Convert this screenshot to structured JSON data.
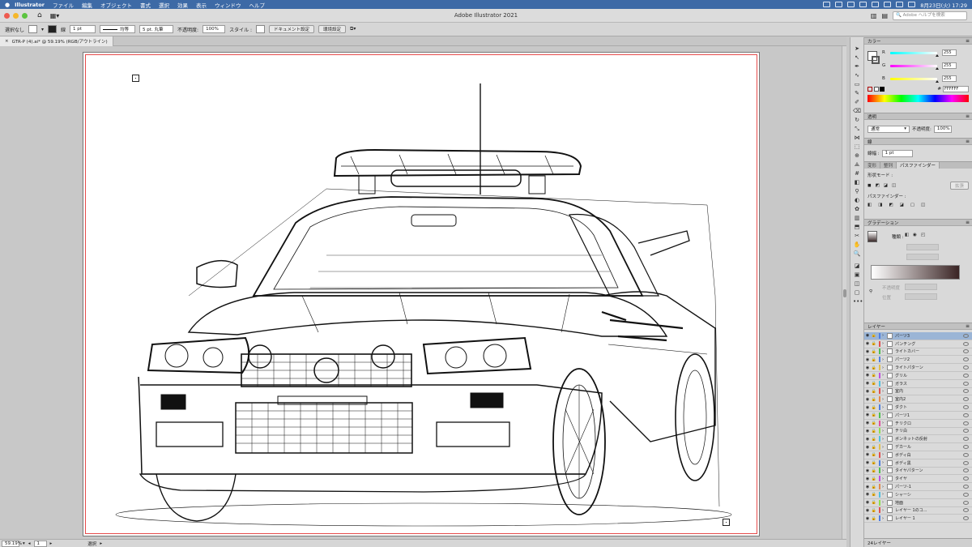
{
  "menubar": {
    "app": "Illustrator",
    "items": [
      "ファイル",
      "編集",
      "オブジェクト",
      "書式",
      "選択",
      "効果",
      "表示",
      "ウィンドウ",
      "ヘルプ"
    ],
    "clock": "8月23日(火) 17:29"
  },
  "window": {
    "title": "Adobe Illustrator 2021",
    "search_placeholder": "Adobe ヘルプを検索"
  },
  "control": {
    "selection": "選択なし",
    "stroke": "1 pt",
    "profile": "均等",
    "brush": "5 pt. 丸筆",
    "opacity_label": "不透明度:",
    "opacity": "100%",
    "style_label": "スタイル :",
    "doc_setup": "ドキュメント設定",
    "prefs": "環境設定"
  },
  "document": {
    "tab": "GTR-P (4).ai* @ 59.19% (RGB/アウトライン)"
  },
  "status": {
    "zoom": "59.19%",
    "artboard": "1",
    "tool": "選択"
  },
  "color_panel": {
    "title": "カラー",
    "r_label": "R",
    "r": "255",
    "g_label": "G",
    "g": "255",
    "b_label": "B",
    "b": "255",
    "hex_label": "#",
    "hex": "FFFFFF"
  },
  "transparency_panel": {
    "title": "透明",
    "mode": "通常",
    "opacity_label": "不透明度:",
    "opacity": "100%"
  },
  "stroke_panel": {
    "title": "線",
    "weight_label": "線幅 :",
    "weight": "1 pt"
  },
  "pathfinder_panel": {
    "tabs": [
      "変形",
      "整列",
      "パスファインダー"
    ],
    "shape_modes": "形状モード :",
    "expand": "拡張",
    "pathfinders": "パスファインダー :"
  },
  "gradient_panel": {
    "title": "グラデーション",
    "type_label": "種類 :",
    "opacity_label": "不透明度",
    "location_label": "位置"
  },
  "layers_panel": {
    "title": "レイヤー",
    "layers": [
      {
        "name": "パーツ3",
        "color": "#4f7fe0",
        "selected": true
      },
      {
        "name": "パンチング",
        "color": "#e04f4f"
      },
      {
        "name": "ライトカバー",
        "color": "#4fc04f"
      },
      {
        "name": "パーツ2",
        "color": "#4f7fe0"
      },
      {
        "name": "ライトパターン",
        "color": "#e0c04f"
      },
      {
        "name": "グリル",
        "color": "#c04fe0"
      },
      {
        "name": "ガラス",
        "color": "#4fc0e0"
      },
      {
        "name": "室内",
        "color": "#e04f4f"
      },
      {
        "name": "室内2",
        "color": "#e08c4f"
      },
      {
        "name": "ダクト",
        "color": "#4f7fe0"
      },
      {
        "name": "パーツ1",
        "color": "#4fc04f"
      },
      {
        "name": "チリクロ",
        "color": "#e04fa0"
      },
      {
        "name": "チリ白",
        "color": "#8ce04f"
      },
      {
        "name": "ボンネットの反射",
        "color": "#4fc0e0"
      },
      {
        "name": "デカール",
        "color": "#e0c04f"
      },
      {
        "name": "ボディ白",
        "color": "#e04f4f"
      },
      {
        "name": "ボディ黒",
        "color": "#4f7fe0"
      },
      {
        "name": "タイヤパターン",
        "color": "#4fc04f"
      },
      {
        "name": "タイヤ",
        "color": "#c04fe0"
      },
      {
        "name": "パーツ-1",
        "color": "#e08c4f"
      },
      {
        "name": "シャーシ",
        "color": "#4fc0e0"
      },
      {
        "name": "地面",
        "color": "#8ce04f"
      },
      {
        "name": "レイヤー 1のコ...",
        "color": "#e04f4f"
      },
      {
        "name": "レイヤー 1",
        "color": "#4f7fe0"
      }
    ],
    "count": "24レイヤー"
  },
  "icons": {
    "apple": "apple-icon",
    "home": "home-icon",
    "search": "search-icon"
  }
}
